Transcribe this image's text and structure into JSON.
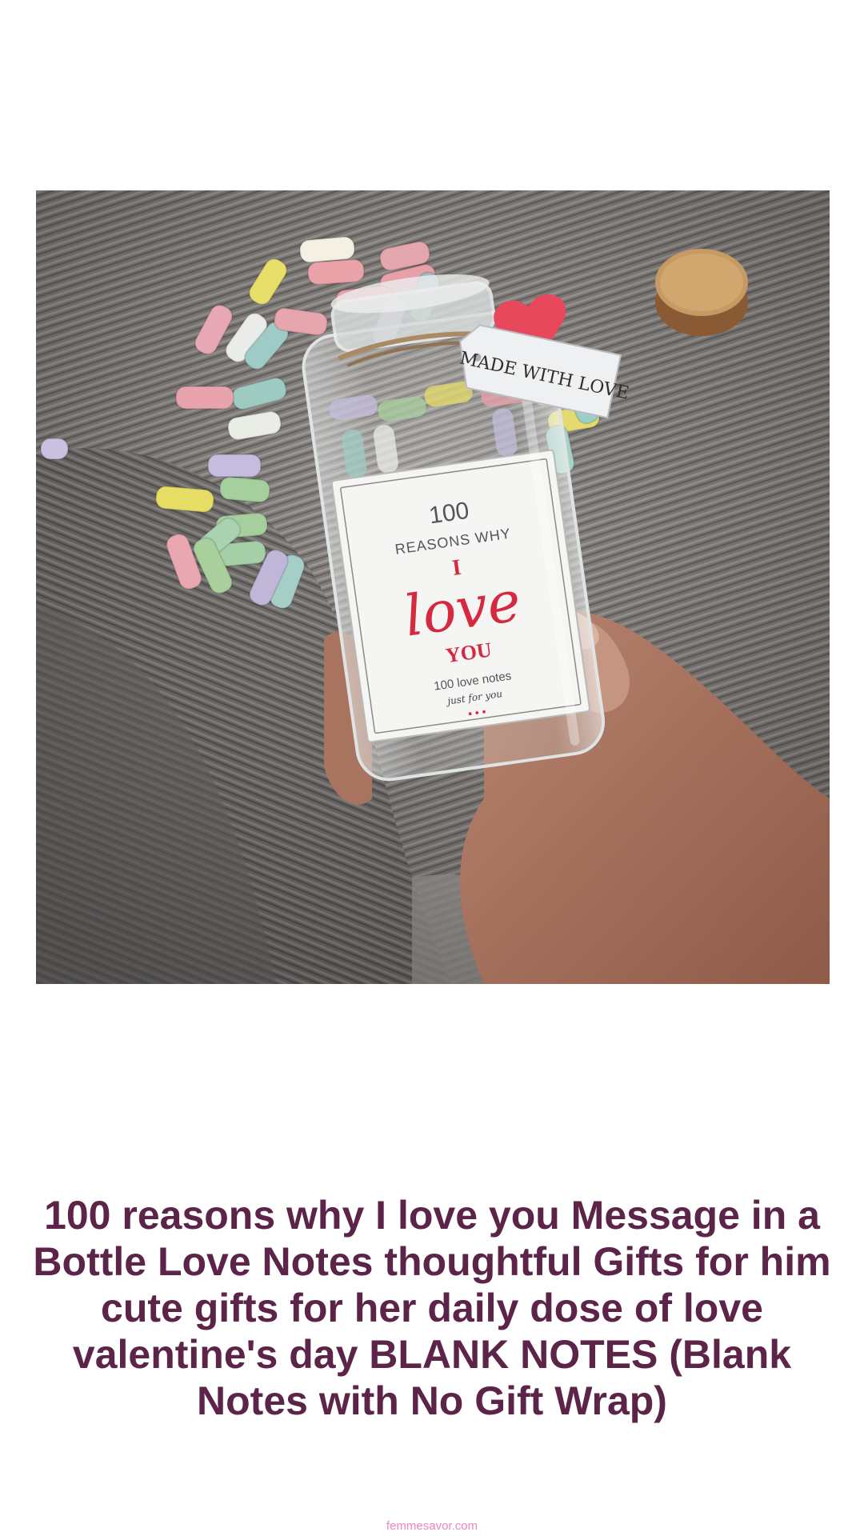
{
  "product": {
    "image_alt": "Glass jar of rolled pastel love notes held in a hand on a grey blanket",
    "jar_label": {
      "number": "100",
      "reasons": "REASONS WHY",
      "i": "I",
      "love": "love",
      "you": "YOU",
      "notes": "100 love notes",
      "just_for_you": "just for you",
      "dots": "• • •"
    },
    "tag_text": "MADE WITH LOVE",
    "title": "100 reasons why I love you Message in a Bottle Love Notes thoughtful Gifts for him cute gifts for her daily dose of love valentine's day BLANK NOTES (Blank Notes with No Gift Wrap)"
  },
  "footer": {
    "source": "femmesavor.com"
  },
  "colors": {
    "title": "#5b2448",
    "source": "#ee84c4",
    "label_red": "#d6283f"
  }
}
